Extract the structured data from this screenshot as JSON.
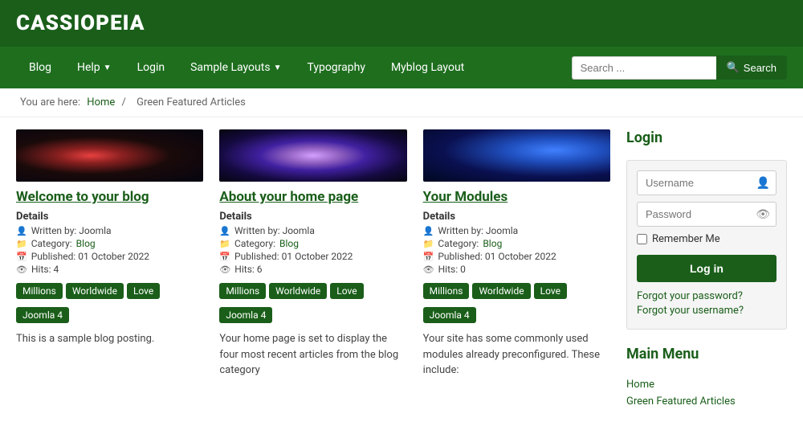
{
  "site": {
    "logo": "CASSIOPEIA"
  },
  "nav": {
    "items": [
      {
        "label": "Blog",
        "has_dropdown": false
      },
      {
        "label": "Help",
        "has_dropdown": true
      },
      {
        "label": "Login",
        "has_dropdown": false
      },
      {
        "label": "Sample Layouts",
        "has_dropdown": true
      },
      {
        "label": "Typography",
        "has_dropdown": false
      },
      {
        "label": "Myblog Layout",
        "has_dropdown": false
      }
    ],
    "search_placeholder": "Search ...",
    "search_btn_label": "Search"
  },
  "breadcrumb": {
    "you_are_here": "You are here:",
    "home_label": "Home",
    "separator": "/",
    "current": "Green Featured Articles"
  },
  "articles": [
    {
      "title": "Welcome to your blog",
      "image_type": "galaxy1",
      "details_label": "Details",
      "written_by": "Written by: Joomla",
      "category_label": "Category:",
      "category": "Blog",
      "published": "Published: 01 October 2022",
      "hits": "Hits: 4",
      "tags": [
        "Millions",
        "Worldwide",
        "Love",
        "Joomla 4"
      ],
      "excerpt": "This is a sample blog posting."
    },
    {
      "title": "About your home page",
      "image_type": "galaxy2",
      "details_label": "Details",
      "written_by": "Written by: Joomla",
      "category_label": "Category:",
      "category": "Blog",
      "published": "Published: 01 October 2022",
      "hits": "Hits: 6",
      "tags": [
        "Millions",
        "Worldwide",
        "Love",
        "Joomla 4"
      ],
      "excerpt": "Your home page is set to display the four most recent articles from the blog category"
    },
    {
      "title": "Your Modules",
      "image_type": "stars",
      "details_label": "Details",
      "written_by": "Written by: Joomla",
      "category_label": "Category:",
      "category": "Blog",
      "published": "Published: 01 October 2022",
      "hits": "Hits: 0",
      "tags": [
        "Millions",
        "Worldwide",
        "Love",
        "Joomla 4"
      ],
      "excerpt": "Your site has some commonly used modules already preconfigured. These include:"
    }
  ],
  "sidebar": {
    "login": {
      "title": "Login",
      "username_placeholder": "Username",
      "password_placeholder": "Password",
      "remember_me": "Remember Me",
      "login_btn": "Log in",
      "forgot_password": "Forgot your password?",
      "forgot_username": "Forgot your username?"
    },
    "main_menu": {
      "title": "Main Menu",
      "items": [
        {
          "label": "Home"
        },
        {
          "label": "Green Featured Articles"
        }
      ]
    }
  }
}
